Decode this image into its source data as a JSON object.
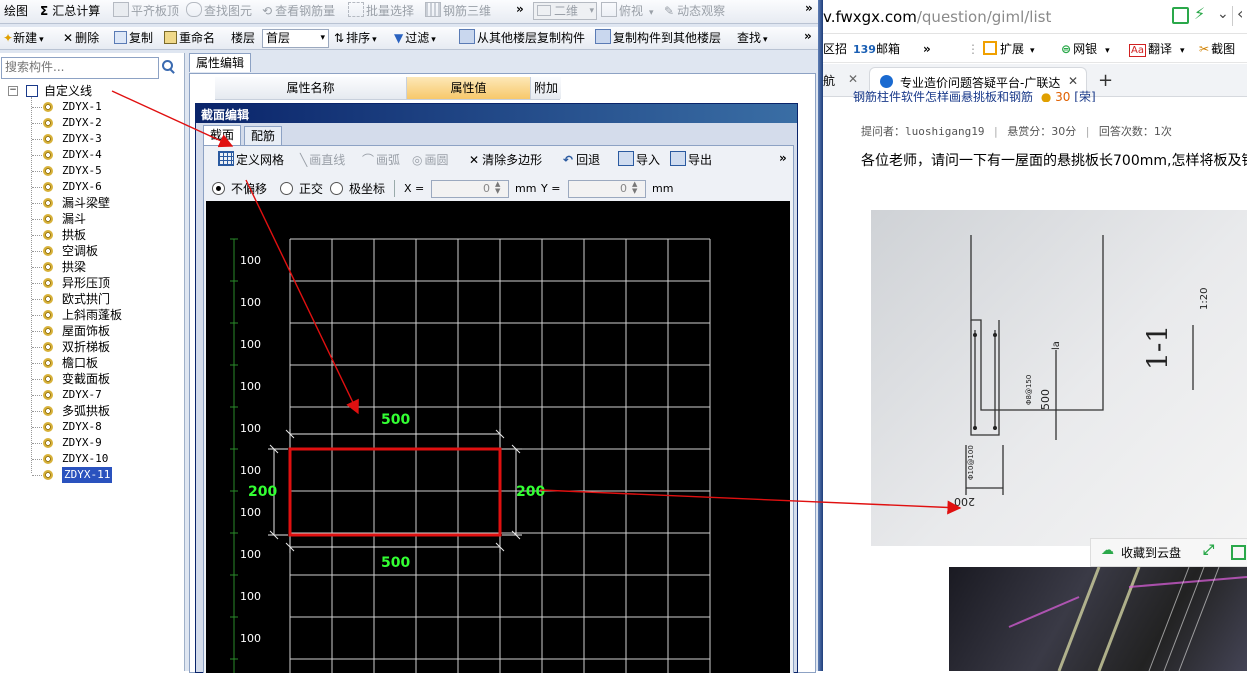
{
  "app": {
    "top_toolbar": {
      "draw": "绘图",
      "sum": "汇总计算",
      "flat_top": "平齐板顶",
      "find_elem": "查找图元",
      "view_rebar_qty": "查看钢筋量",
      "batch_select": "批量选择",
      "rebar_3d": "钢筋三维",
      "view_mode": "二维",
      "top_view": "俯视",
      "dynamic_view": "动态观察"
    },
    "second_toolbar": {
      "new": "新建",
      "delete": "删除",
      "copy": "复制",
      "rename": "重命名",
      "floor_label": "楼层",
      "floor_value": "首层",
      "sort": "排序",
      "filter": "过滤",
      "copy_from_floor": "从其他楼层复制构件",
      "copy_to_floor": "复制构件到其他楼层",
      "find": "查找"
    },
    "search": {
      "placeholder": "搜索构件..."
    },
    "tree": {
      "root": "自定义线",
      "items": [
        "ZDYX-1",
        "ZDYX-2",
        "ZDYX-3",
        "ZDYX-4",
        "ZDYX-5",
        "ZDYX-6",
        "漏斗梁壁",
        "漏斗",
        "拱板",
        "空调板",
        "拱梁",
        "异形压顶",
        "欧式拱门",
        "上斜雨蓬板",
        "屋面饰板",
        "双折梯板",
        "檐口板",
        "变截面板",
        "ZDYX-7",
        "多弧拱板",
        "ZDYX-8",
        "ZDYX-9",
        "ZDYX-10",
        "ZDYX-11"
      ],
      "selected": "ZDYX-11"
    },
    "property_panel": {
      "tab": "属性编辑",
      "col_name": "属性名称",
      "col_value": "属性值",
      "col_extra": "附加"
    },
    "section_editor": {
      "title": "截面编辑",
      "tabs": [
        "截面",
        "配筋"
      ],
      "toolbar": {
        "define_grid": "定义网格",
        "line": "画直线",
        "arc": "画弧",
        "circle": "画圆",
        "clear_polygon": "清除多边形",
        "undo": "回退",
        "import": "导入",
        "export": "导出"
      },
      "coord": {
        "no_offset": "不偏移",
        "ortho": "正交",
        "polar": "极坐标",
        "x_label": "X =",
        "x_value": "0",
        "y_label": "Y =",
        "y_value": "0",
        "unit": "mm"
      },
      "grid_labels": [
        "100",
        "100",
        "100",
        "100",
        "100",
        "100",
        "100",
        "100",
        "100",
        "100"
      ],
      "dims": {
        "top": "500",
        "bottom": "500",
        "left": "200",
        "right": "200"
      }
    }
  },
  "browser": {
    "url_prefix": "v.",
    "url_host": "fwxgx.com",
    "url_path": "/question/giml/list",
    "bookmarks": {
      "zone": "区招",
      "mail_num": "139",
      "mail": "邮箱",
      "ext": "扩展",
      "bank": "网银",
      "translate": "翻译",
      "screenshot": "截图"
    },
    "tabs": {
      "prev": "航",
      "active": "专业造价问题答疑平台-广联达",
      "new": "+"
    },
    "question": {
      "cut_title": "钢筋柱件软件怎样画悬挑板和钢筋",
      "reward_badge": "30",
      "cut_title_tail": "[荣]",
      "meta_asker_label": "提问者：",
      "meta_asker": "luoshigang19",
      "meta_reward": "悬赏分：30分",
      "meta_answers": "回答次数：1次",
      "body": "各位老师，请问一下有一屋面的悬挑板长700mm,怎样将板及钢"
    },
    "cloud_save": "收藏到云盘",
    "drawing_labels": {
      "title": "1-1",
      "scale": "1:20",
      "dim_500": "500",
      "dim_200": "200",
      "la": "la",
      "rebar_a": "Φ8@150",
      "rebar_b": "Φ10@100"
    }
  },
  "colors": {
    "selection": "#2a52be",
    "rect": "#e01010",
    "dim_text": "#33ff33",
    "arrow": "#e01010",
    "grid": "#cfcfcf"
  }
}
